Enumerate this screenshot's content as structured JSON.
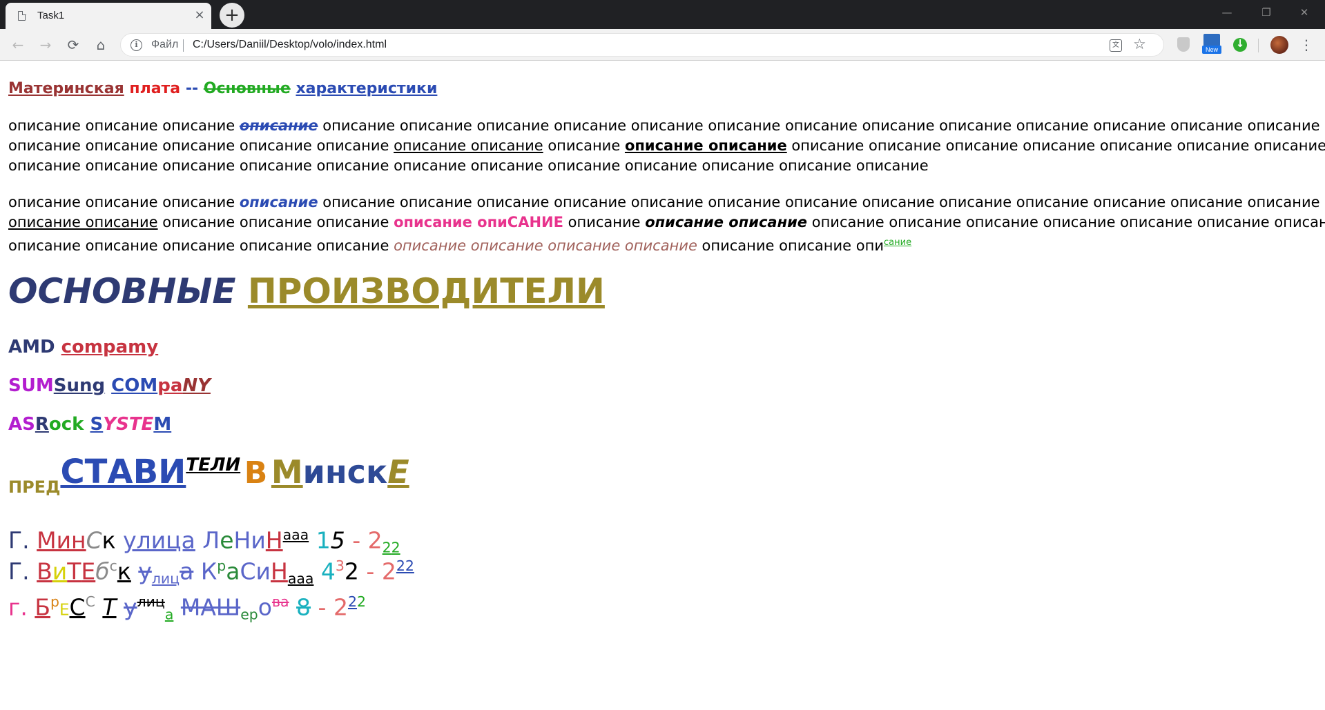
{
  "browser": {
    "tab_title": "Task1",
    "tab_close": "×",
    "new_tab": "+",
    "window_controls": {
      "minimize": "—",
      "restore": "❐",
      "close": "✕"
    },
    "nav": {
      "back": "←",
      "forward": "→",
      "reload": "⟳",
      "home": "⌂"
    },
    "scheme_label": "Файл",
    "url": "C:/Users/Daniil/Desktop/volo/index.html",
    "translate_icon": "文",
    "star_icon": "☆",
    "menu_icon": "⋮",
    "extension_new_label": "New"
  },
  "colors": {
    "maroon": "#993333",
    "red": "#e01f1f",
    "blue": "#2b4bb3",
    "green": "#22aa22",
    "navy": "#2e3a73",
    "olive": "#9b8a2a",
    "crimson": "#c73340",
    "purple": "#b31ecf",
    "pink": "#e8338d",
    "orange": "#d98213",
    "teal": "#1ab1bf",
    "salmon": "#e46a6a",
    "indigo": "#5a66c9",
    "grey": "#8a8a8a",
    "dark_green": "#2a8a3a",
    "yellow": "#d6d10a",
    "rose": "#c85a70"
  },
  "heading": {
    "w1": "Материнская",
    "w2": "плата",
    "sep": "--",
    "w3": "Основные",
    "w4": "характеристики"
  },
  "word": "описание",
  "para1": {
    "l1a": "описание описание описание ",
    "l1b": "описание",
    "l1c": " описание описание описание описание описание описание описание описание описание описание описание описание описание опис",
    "l2a": "описание описание описание описание описание ",
    "l2b": "описание описание",
    "l2c": " описание ",
    "l2d": "описание описание",
    "l2e": " описание описание описание описание описание описание описание описание опис",
    "l3": "описание описание описание описание описание описание описание описание описание описание описание описание"
  },
  "para2": {
    "l1a": "описание описание описание ",
    "l1b": "описание",
    "l1c": " описание описание описание описание описание описание описание описание описание описание описание описание описание опис",
    "l2a": "описание описание",
    "l2b": " описание описание описание ",
    "l2c": "описание опиСАНИЕ",
    "l2d": " описание ",
    "l2e": "описание описание",
    "l2f": " описание описание описание описание описание описание описание описание",
    "l3a": "описание описание описание описание описание ",
    "l3b": "описание описание описание описание",
    "l3c": " описание описание опи",
    "l3d": "сание"
  },
  "manufacturers": {
    "w1": "ОСНОВНЫЕ",
    "w2": "ПРОИЗВОДИТЕЛИ"
  },
  "companies": {
    "amd": {
      "a": "AMD",
      "b": "compamy"
    },
    "samsung": {
      "a": "SUM",
      "b": "Sung",
      "c": "COM",
      "d": "pa",
      "e": "NY"
    },
    "asrock": {
      "a": "AS",
      "b": "R",
      "c": "ock",
      "d": "S",
      "e": "YSTE",
      "f": "M"
    }
  },
  "representatives": {
    "pred": "ПРЕД",
    "stavi": "СТАВИ",
    "teli": "ТЕЛИ",
    "v": "В",
    "m": "М",
    "insk": "инск",
    "e": "Е"
  },
  "addresses": [
    {
      "g": "Г.",
      "city_a": "Мин",
      "city_b": "С",
      "city_c": "к",
      "street": "улица",
      "name_a": "Л",
      "name_b": "е",
      "name_c": "Н",
      "name_d": "и",
      "name_e": "Н",
      "name_sup": "ааа",
      "n1": "1",
      "n2": "5",
      "dash": "-",
      "f1": "2",
      "f2": "2",
      "f3": "2"
    },
    {
      "g": "Г.",
      "city_a": "В",
      "city_b": "и",
      "city_c": "Т",
      "city_d": "Е",
      "city_e": "б",
      "city_f": "с",
      "city_g": "к",
      "street_a": "у",
      "street_b": "лиц",
      "street_c": "а",
      "name_a": "К",
      "name_b": "р",
      "name_c": "а",
      "name_d": "С",
      "name_e": "и",
      "name_f": "Н",
      "name_g": "ааа",
      "n1": "4",
      "n2": "3",
      "n3": "2",
      "dash": "-",
      "f1": "2",
      "f2": "22"
    },
    {
      "g": "г.",
      "city_a": "Б",
      "city_b": "р",
      "city_c": "Е",
      "city_d": "С",
      "city_e": "С",
      "city_f": "Т",
      "street_a": "у",
      "street_b": "лиц",
      "street_c": "а",
      "name_a": "МАШ",
      "name_b": "ер",
      "name_c": "о",
      "name_d": "ва",
      "n1": "8",
      "dash": "-",
      "f1": "2",
      "f2": "2",
      "f3": "2"
    }
  ]
}
